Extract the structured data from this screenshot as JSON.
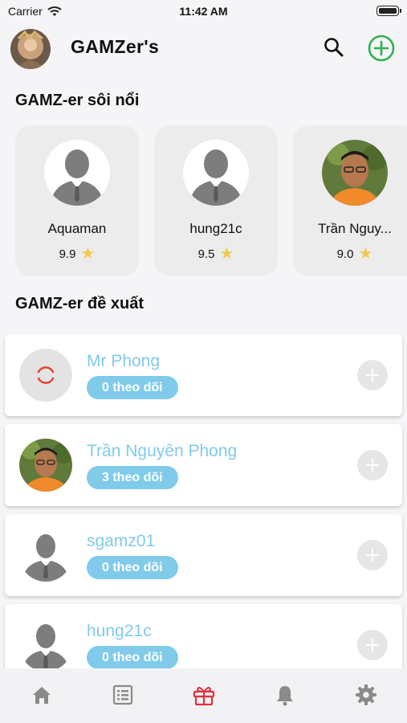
{
  "status_bar": {
    "carrier": "Carrier",
    "time": "11:42 AM"
  },
  "app_bar": {
    "title": "GAMZer's"
  },
  "hot_section": {
    "title": "GAMZ-er sôi nổi",
    "items": [
      {
        "name": "Aquaman",
        "rating": "9.9",
        "avatar": "silhouette"
      },
      {
        "name": "hung21c",
        "rating": "9.5",
        "avatar": "silhouette"
      },
      {
        "name": "Trần Nguy...",
        "rating": "9.0",
        "avatar": "photo"
      }
    ]
  },
  "suggest_section": {
    "title": "GAMZ-er đề xuất",
    "items": [
      {
        "name": "Mr Phong",
        "followers": "0 theo dõi",
        "avatar": "loading"
      },
      {
        "name": "Trần Nguyên Phong",
        "followers": "3 theo dõi",
        "avatar": "photo"
      },
      {
        "name": "sgamz01",
        "followers": "0 theo dõi",
        "avatar": "silhouette"
      },
      {
        "name": "hung21c",
        "followers": "0 theo dõi",
        "avatar": "silhouette"
      }
    ]
  },
  "tab_bar": {
    "tabs": [
      {
        "icon": "home-icon",
        "active": false
      },
      {
        "icon": "list-icon",
        "active": false
      },
      {
        "icon": "gift-icon",
        "active": true
      },
      {
        "icon": "bell-icon",
        "active": false
      },
      {
        "icon": "gear-icon",
        "active": false
      }
    ]
  },
  "colors": {
    "accent_green": "#2fb14c",
    "username_blue": "#80cbea",
    "active_tab_red": "#e0323c",
    "inactive_tab": "#8a8a8a",
    "star": "#f2c94c"
  }
}
